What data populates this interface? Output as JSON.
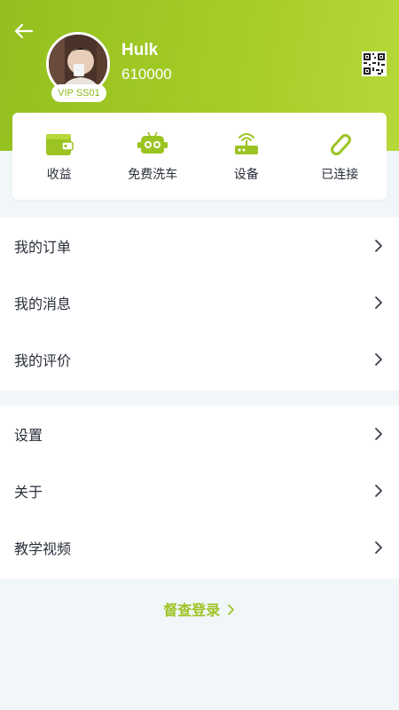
{
  "colors": {
    "accent": "#9bc422",
    "accent_light": "#b7d83a",
    "page_bg": "#f1f6f8"
  },
  "header": {
    "back_icon": "arrow-left-icon",
    "qr_icon": "qr-code-icon",
    "user": {
      "name": "Hulk",
      "id": "610000",
      "vip_label": "VIP SS01"
    }
  },
  "quick_actions": [
    {
      "label": "收益",
      "icon": "wallet-icon"
    },
    {
      "label": "免费洗车",
      "icon": "robot-car-wash-icon"
    },
    {
      "label": "设备",
      "icon": "router-device-icon"
    },
    {
      "label": "已连接",
      "icon": "paperclip-link-icon"
    }
  ],
  "menu_group_1": [
    {
      "label": "我的订单"
    },
    {
      "label": "我的消息"
    },
    {
      "label": "我的评价"
    }
  ],
  "menu_group_2": [
    {
      "label": "设置"
    },
    {
      "label": "关于"
    },
    {
      "label": "教学视频"
    }
  ],
  "inspect_login": {
    "label": "督查登录"
  }
}
